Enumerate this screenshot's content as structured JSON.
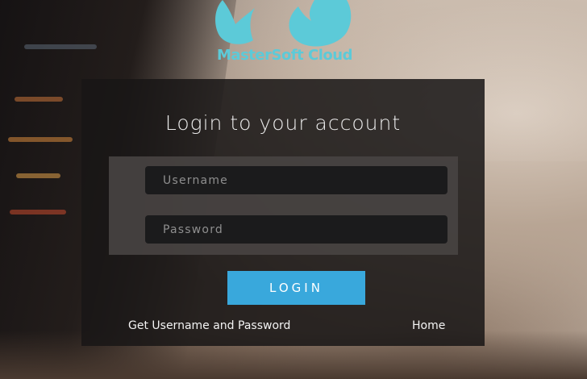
{
  "brand": {
    "name": "MasterSoft Cloud",
    "color": "#5ccad8",
    "logo_icon": "cloud-logo-icon"
  },
  "login": {
    "title": "Login to your account",
    "username": {
      "placeholder": "Username",
      "value": ""
    },
    "password": {
      "placeholder": "Password",
      "value": ""
    },
    "submit_label": "LOGIN",
    "submit_color": "#39a8dc"
  },
  "links": {
    "get_credentials": "Get Username and Password",
    "home": "Home"
  }
}
